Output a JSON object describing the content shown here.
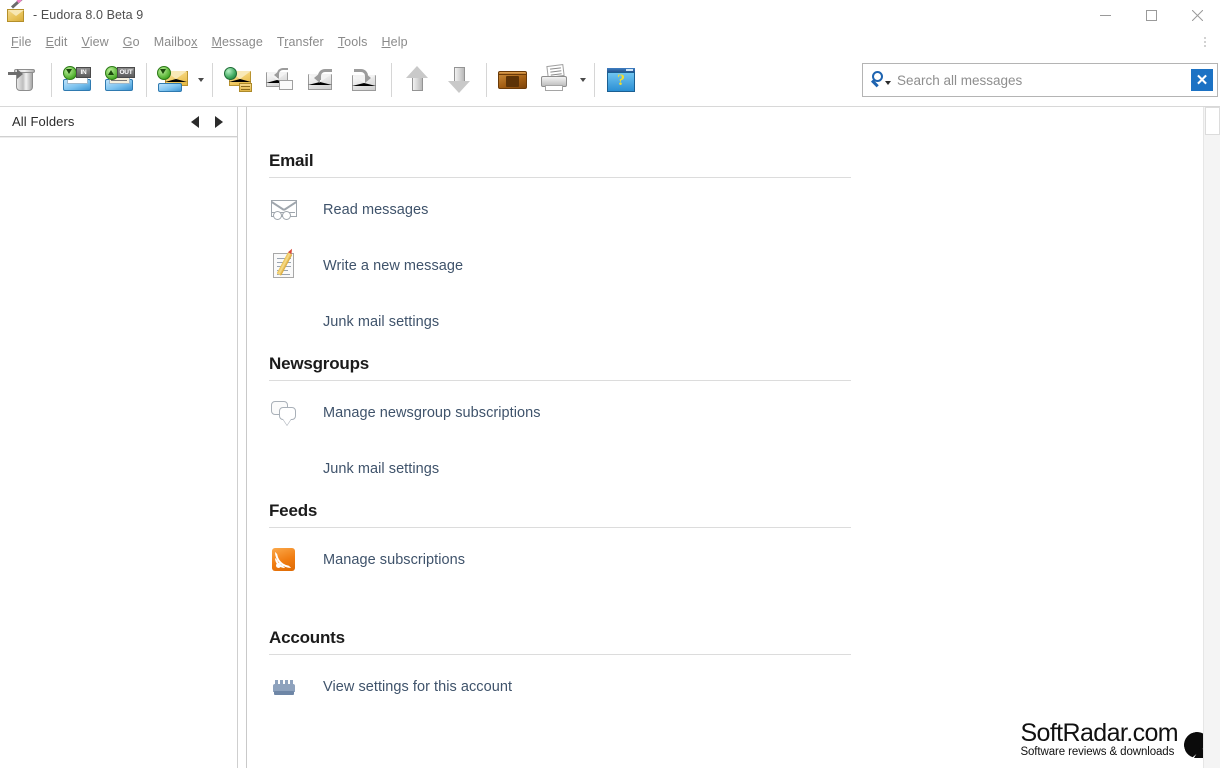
{
  "window": {
    "title": "- Eudora 8.0 Beta 9",
    "app_icon": "eudora-envelope-pen-icon",
    "controls": {
      "minimize": "minimize-icon",
      "maximize": "maximize-icon",
      "close": "close-icon"
    }
  },
  "menubar": {
    "items": [
      {
        "label": "File",
        "mnemonic": "F"
      },
      {
        "label": "Edit",
        "mnemonic": "E"
      },
      {
        "label": "View",
        "mnemonic": "V"
      },
      {
        "label": "Go",
        "mnemonic": "G"
      },
      {
        "label": "Mailbox",
        "mnemonic": "x"
      },
      {
        "label": "Message",
        "mnemonic": "M"
      },
      {
        "label": "Transfer",
        "mnemonic": "r"
      },
      {
        "label": "Tools",
        "mnemonic": "T"
      },
      {
        "label": "Help",
        "mnemonic": "H"
      }
    ]
  },
  "toolbar": {
    "buttons": [
      {
        "name": "trash-button",
        "icon": "trash-can-icon"
      },
      {
        "name": "in-mailbox-button",
        "icon": "inbox-tray-icon"
      },
      {
        "name": "out-mailbox-button",
        "icon": "outbox-tray-icon"
      },
      {
        "name": "check-mail-button",
        "icon": "receive-mail-icon"
      },
      {
        "name": "send-queued-button",
        "icon": "globe-mail-icon"
      },
      {
        "name": "reply-button",
        "icon": "reply-envelope-icon"
      },
      {
        "name": "reply-all-button",
        "icon": "reply-all-envelope-icon"
      },
      {
        "name": "forward-button",
        "icon": "forward-envelope-icon"
      },
      {
        "name": "previous-message-button",
        "icon": "arrow-up-icon"
      },
      {
        "name": "next-message-button",
        "icon": "arrow-down-icon"
      },
      {
        "name": "address-book-button",
        "icon": "address-book-icon"
      },
      {
        "name": "print-button",
        "icon": "printer-icon"
      },
      {
        "name": "help-button",
        "icon": "help-window-icon"
      }
    ]
  },
  "search": {
    "icon": "search-magnifier-icon",
    "dropdown_icon": "chevron-down-icon",
    "value": "",
    "placeholder": "Search all messages",
    "clear_label": "✕"
  },
  "sidebar": {
    "title": "All Folders",
    "back_icon": "triangle-left-icon",
    "forward_icon": "triangle-right-icon",
    "items": []
  },
  "main": {
    "sections": [
      {
        "heading": "Email",
        "rows": [
          {
            "label": "Read messages",
            "icon": "read-mail-icon",
            "indent": false
          },
          {
            "label": "Write a new message",
            "icon": "compose-icon",
            "indent": false
          },
          {
            "label": "Junk mail settings",
            "icon": "none",
            "indent": true
          }
        ]
      },
      {
        "heading": "Newsgroups",
        "rows": [
          {
            "label": "Manage newsgroup subscriptions",
            "icon": "chat-bubbles-icon",
            "indent": false
          },
          {
            "label": "Junk mail settings",
            "icon": "none",
            "indent": true
          }
        ]
      },
      {
        "heading": "Feeds",
        "rows": [
          {
            "label": "Manage subscriptions",
            "icon": "rss-feed-icon",
            "indent": false
          }
        ]
      },
      {
        "heading": "Accounts",
        "rows": [
          {
            "label": "View settings for this account",
            "icon": "account-gear-icon",
            "indent": false
          }
        ]
      }
    ]
  },
  "watermark": {
    "title": "SoftRadar.com",
    "tagline": "Software reviews & downloads",
    "icon": "satellite-dish-icon"
  },
  "colors": {
    "link": "#3f536b",
    "heading": "#1b1b1b",
    "menu_text": "#8a8a8a",
    "rss_orange": "#f07c11",
    "search_accent": "#1c72c4"
  }
}
